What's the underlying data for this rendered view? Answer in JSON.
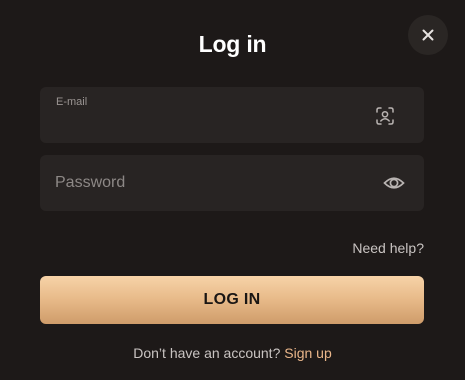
{
  "dialog": {
    "title": "Log in",
    "close_icon": "close-icon"
  },
  "email_field": {
    "label": "E-mail",
    "value": "",
    "placeholder": "",
    "icon": "face-id-icon"
  },
  "password_field": {
    "value": "",
    "placeholder": "Password",
    "icon": "eye-icon"
  },
  "help_link": "Need help?",
  "login_button": "LOG IN",
  "signup": {
    "prompt": "Don’t have an account?",
    "link": "Sign up"
  },
  "colors": {
    "background": "#1d1918",
    "field_bg": "#282423",
    "button_gradient_top": "#f7d3a8",
    "button_gradient_bottom": "#cf9c6a",
    "link_accent": "#eab68a"
  }
}
